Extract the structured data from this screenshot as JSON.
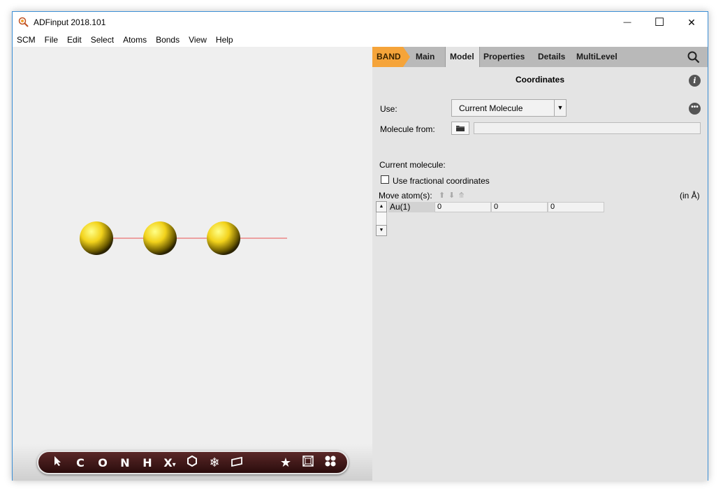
{
  "window": {
    "title": "ADFinput 2018.101",
    "minimize_glyph": "—",
    "maximize_glyph": "☐",
    "close_glyph": "✕"
  },
  "menu": [
    "SCM",
    "File",
    "Edit",
    "Select",
    "Atoms",
    "Bonds",
    "View",
    "Help"
  ],
  "toolbar": {
    "items": [
      "C",
      "O",
      "N",
      "H",
      "X"
    ],
    "x_dropdown_glyph": "▾",
    "icons": [
      "select-arrow-icon",
      "ring-icon",
      "snowflake-icon",
      "plane-icon",
      "star-icon",
      "cell-icon",
      "atoms-display-icon"
    ]
  },
  "molecule": {
    "atoms": [
      {
        "element": "Au"
      },
      {
        "element": "Au"
      },
      {
        "element": "Au"
      }
    ],
    "atom_color": "#f2d21b",
    "bond_color": "#e85050"
  },
  "panel": {
    "tabs": [
      "BAND",
      "Main",
      "Model",
      "Properties",
      "Details",
      "MultiLevel"
    ],
    "active_tab": "Model",
    "section_title": "Coordinates",
    "info_glyph": "i",
    "more_glyph": "•••",
    "use_label": "Use:",
    "use_value": "Current Molecule",
    "select_arrow": "▼",
    "molecule_from_label": "Molecule from:",
    "current_molecule_label": "Current molecule:",
    "fractional_label": "Use fractional coordinates",
    "move_atoms_label": "Move atom(s):",
    "move_arrows": [
      "⬆",
      "⬇",
      "⤊"
    ],
    "units_label": "(in Å)",
    "scroll_up": "▲",
    "scroll_down": "▼",
    "coordinates": [
      {
        "atom": "Au(1)",
        "x": "0",
        "y": "0",
        "z": "0"
      }
    ]
  }
}
